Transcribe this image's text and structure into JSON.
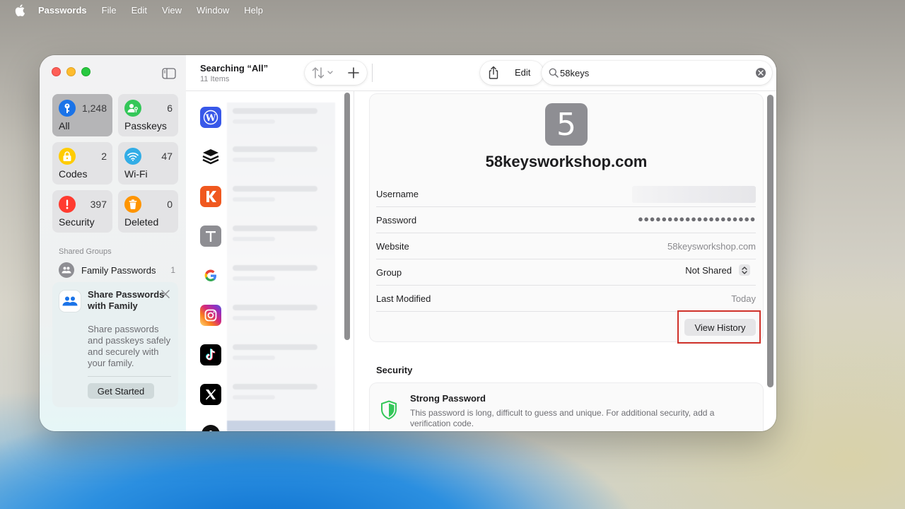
{
  "menubar": {
    "app": "Passwords",
    "items": [
      "File",
      "Edit",
      "View",
      "Window",
      "Help"
    ]
  },
  "sidebar": {
    "tiles": [
      {
        "label": "All",
        "count": "1,248",
        "icon": "key-icon",
        "color": "#1a73e8",
        "selected": true
      },
      {
        "label": "Passkeys",
        "count": "6",
        "icon": "person-key-icon",
        "color": "#34c759"
      },
      {
        "label": "Codes",
        "count": "2",
        "icon": "lock-clock-icon",
        "color": "#ffcc00"
      },
      {
        "label": "Wi-Fi",
        "count": "47",
        "icon": "wifi-icon",
        "color": "#32ade6"
      },
      {
        "label": "Security",
        "count": "397",
        "icon": "exclamation-icon",
        "color": "#ff3b30"
      },
      {
        "label": "Deleted",
        "count": "0",
        "icon": "trash-icon",
        "color": "#ff9500"
      }
    ],
    "shared_groups_title": "Shared Groups",
    "family": {
      "name": "Family Passwords",
      "count": "1"
    },
    "share_card": {
      "title": "Share Passwords with Family",
      "body": "Share passwords and passkeys safely and securely with your family.",
      "button": "Get Started"
    }
  },
  "list": {
    "title": "Searching “All”",
    "subtitle": "11 Items",
    "icons": [
      "wordpress-icon",
      "buffer-icon",
      "k-app-icon",
      "t-letter-icon",
      "google-icon",
      "instagram-icon",
      "tiktok-icon",
      "x-icon",
      "partial-icon"
    ]
  },
  "toolbar": {
    "edit_label": "Edit",
    "search_value": "58keys"
  },
  "detail": {
    "icon_letter": "5",
    "site_name": "58keysworkshop.com",
    "fields": {
      "username_label": "Username",
      "password_label": "Password",
      "password_value": "●●●●●●●●●●●●●●●●●●●●",
      "website_label": "Website",
      "website_value": "58keysworkshop.com",
      "group_label": "Group",
      "group_value": "Not Shared",
      "modified_label": "Last Modified",
      "modified_value": "Today"
    },
    "history_button": "View History",
    "security_title": "Security",
    "security_item_title": "Strong Password",
    "security_item_desc": "This password is long, difficult to guess and unique. For additional security, add a verification code."
  },
  "colors": {
    "highlight": "#d0322a",
    "shield": "#34c759"
  }
}
